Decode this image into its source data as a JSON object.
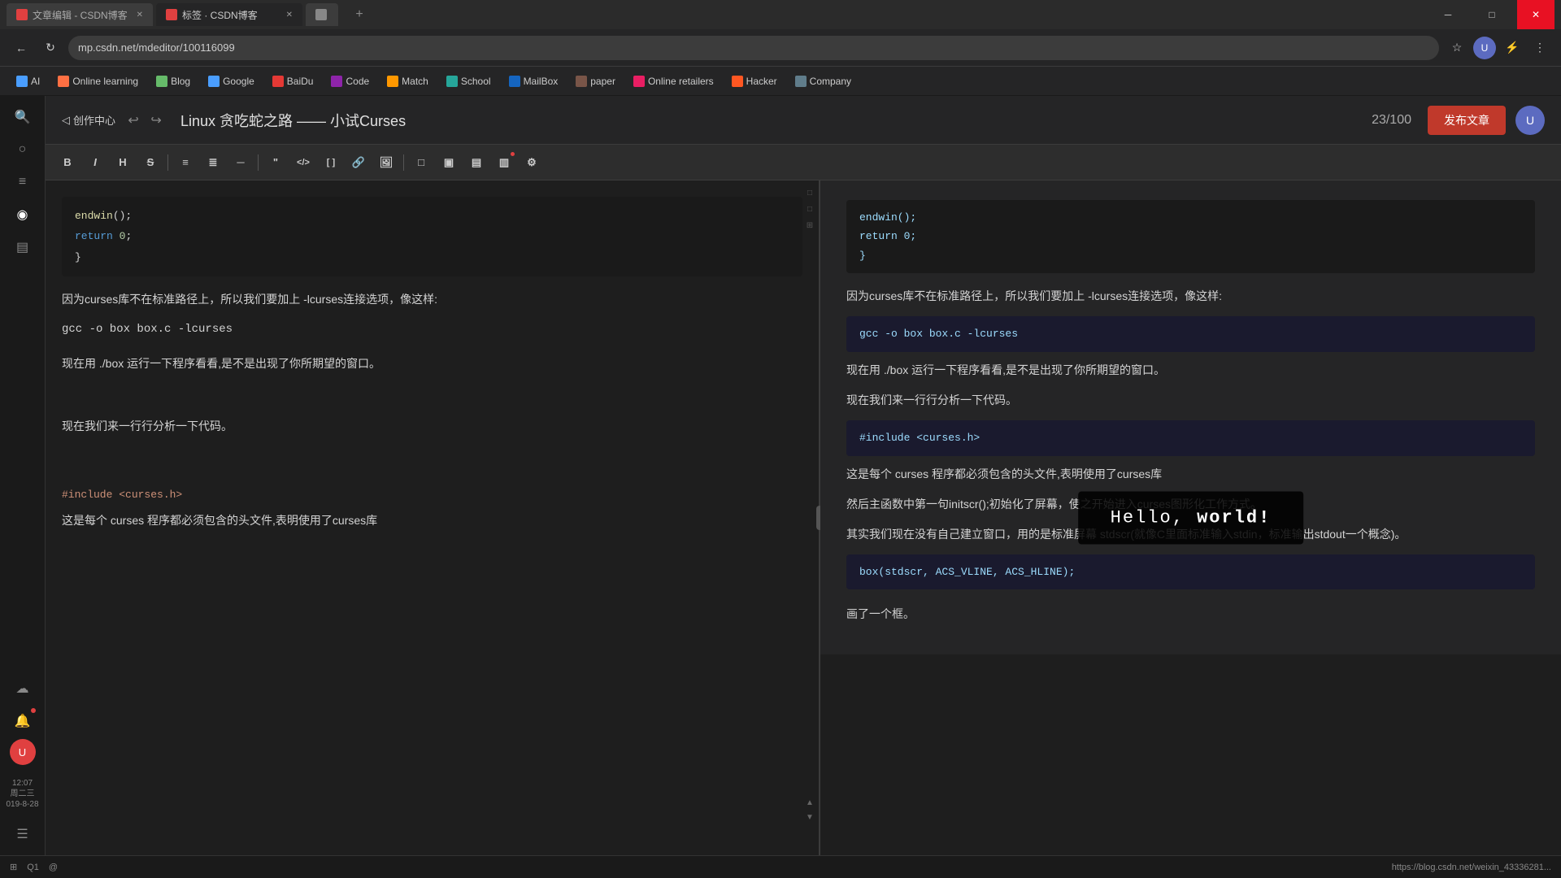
{
  "browser": {
    "tabs": [
      {
        "id": "tab1",
        "label": "文章编辑 - CSDN博客",
        "active": false,
        "icon_color": "#e04040"
      },
      {
        "id": "tab2",
        "label": "标签 · CSDN博客",
        "active": true,
        "icon_color": "#e04040"
      },
      {
        "id": "tab3",
        "label": "",
        "active": false,
        "icon_color": "#888"
      }
    ],
    "address": "mp.csdn.net/mdeditor/100116099",
    "back_btn": "←",
    "refresh_btn": "↻"
  },
  "bookmarks": [
    {
      "label": "AI",
      "color": "#4a9eff"
    },
    {
      "label": "Online learning",
      "color": "#ff7043"
    },
    {
      "label": "Blog",
      "color": "#66bb6a"
    },
    {
      "label": "Google",
      "color": "#4a9eff"
    },
    {
      "label": "BaiDu",
      "color": "#e53935"
    },
    {
      "label": "Code",
      "color": "#8e24aa"
    },
    {
      "label": "Match",
      "color": "#ff9800"
    },
    {
      "label": "School",
      "color": "#26a69a"
    },
    {
      "label": "MailBox",
      "color": "#1565c0"
    },
    {
      "label": "paper",
      "color": "#795548"
    },
    {
      "label": "Online retailers",
      "color": "#e91e63"
    },
    {
      "label": "Hacker",
      "color": "#ff5722"
    },
    {
      "label": "Company",
      "color": "#607d8b"
    }
  ],
  "editor": {
    "title": "Linux 贪吃蛇之路 —— 小试Curses",
    "counter": "23/100",
    "publish_btn": "发布文章",
    "back_label": "◁ 创作中心",
    "toolbar_items": [
      "B",
      "I",
      "H",
      "S",
      "≡",
      "≣",
      "─",
      "{ }",
      "</>",
      "□□",
      "🔗",
      "🖼",
      "□",
      "▣",
      "▤",
      "▥",
      "⚙"
    ]
  },
  "editor_content": {
    "lines": [
      "    endwin();",
      "    return 0;",
      "}"
    ],
    "paragraphs": [
      "因为curses库不在标准路径上，所以我们要加上 -lcurses连接选项，像这样:",
      "gcc -o box box.c -lcurses",
      "现在用 ./box 运行一下程序看看,是不是出现了你所期望的窗口。",
      "现在我们来一行行分析一下代码。",
      "#include <curses.h>",
      "这是每个 curses 程序都必须包含的头文件,表明使用了curses库"
    ]
  },
  "preview_content": {
    "paragraphs": [
      "因为curses库不在标准路径上，所以我们要加上 -lcurses连接选项，像这样:",
      "gcc -o box box.c -lcurses",
      "现在用 ./box 运行一下程序看看,是不是出现了你所期望的窗口。",
      "现在我们来一行行分析一下代码。",
      "#include <curses.h>",
      "这是每个 curses 程序都必须包含的头文件,表明使用了curses库",
      "然后主函数中第一句initscr();初始化了屏幕，使之开始进入curses图形化工作方式。",
      "其实我们现在没有自己建立窗口，用的是标准屏幕 stdscr(就像C里面标准输入stdin，标准输出stdout一个概念)。",
      "box(stdscr, ACS_VLINE, ACS_HLINE);",
      "画了一个框。"
    ],
    "code_blocks": [
      "gcc -o box box.c -lcurses",
      "#include <curses.h>",
      "    initscr();",
      "    box(stdscr, ACS_VLINE, ACS_HLINE);"
    ]
  },
  "hello_world": {
    "text": "Hello, world!",
    "normal_part": "Hello,  ",
    "bold_part": "world!"
  },
  "status_bar": {
    "time": "12:07",
    "date": "周二三",
    "date2": "019-8-28",
    "bottom_link": "https://blog.csdn.net/weixin_43336281..."
  },
  "sidebar_icons": {
    "icons": [
      "⊞",
      "☉",
      "≡",
      "◎",
      "▣",
      "☁",
      "⚙"
    ]
  }
}
